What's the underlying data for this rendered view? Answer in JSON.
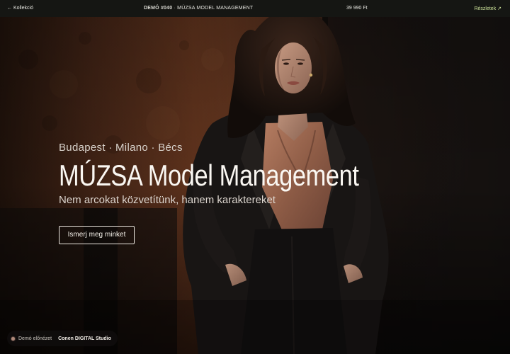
{
  "topbar": {
    "back_label": "← Kollekció",
    "demo_tag": "DEMÓ #040",
    "separator": "·",
    "site_name": "MÚZSA MODEL MANAGEMENT",
    "price": "39 990 Ft",
    "details_label": "Részletek ↗"
  },
  "hero": {
    "cities": "Budapest · Milano · Bécs",
    "headline": "MÚZSA Model Management",
    "tagline": "Nem arcokat közvetítünk, hanem karaktereket",
    "cta_label": "Ismerj meg minket",
    "image_icon": "model-portrait-photo"
  },
  "badge": {
    "label": "Demó előnézet",
    "studio": "Conen DIGITAL Studio"
  },
  "colors": {
    "topbar_bg": "#151613",
    "accent_link": "#cde39a",
    "wall_rust": "#6b3a22",
    "blouse_satin": "#9a6a52",
    "text_light": "#faf7f2"
  }
}
